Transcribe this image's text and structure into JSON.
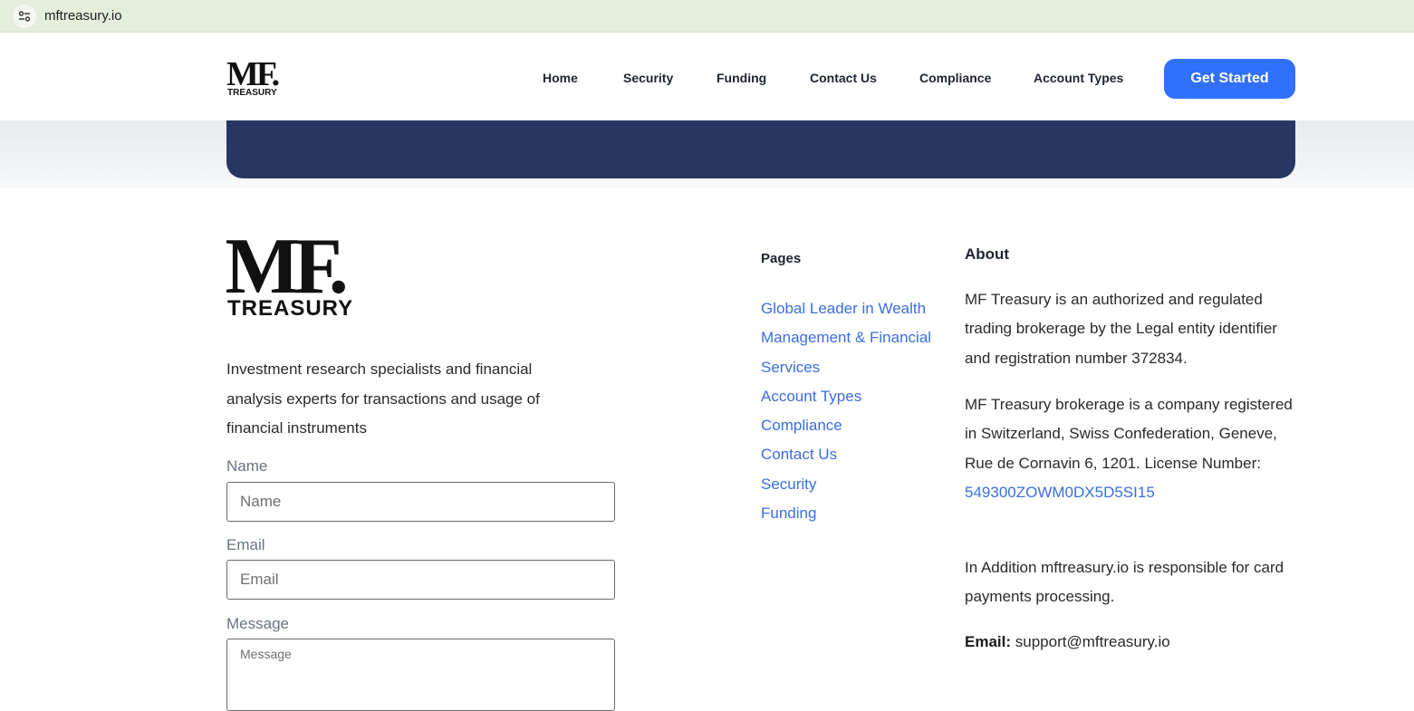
{
  "browser": {
    "url": "mftreasury.io"
  },
  "logo": {
    "mark": "MF.",
    "word": "TREASURY"
  },
  "nav": {
    "items": [
      {
        "label": "Home"
      },
      {
        "label": "Security"
      },
      {
        "label": "Funding"
      },
      {
        "label": "Contact Us"
      },
      {
        "label": "Compliance"
      },
      {
        "label": "Account Types"
      }
    ],
    "cta_label": "Get Started"
  },
  "footer": {
    "description": "Investment research specialists and financial analysis experts for transactions and usage of financial instruments",
    "form": {
      "name_label": "Name",
      "name_placeholder": "Name",
      "email_label": "Email",
      "email_placeholder": "Email",
      "message_label": "Message",
      "message_placeholder": "Message"
    },
    "pages": {
      "title": "Pages",
      "links": [
        {
          "label": "Global Leader in Wealth Management & Financial Services"
        },
        {
          "label": "Account Types"
        },
        {
          "label": "Compliance"
        },
        {
          "label": "Contact Us"
        },
        {
          "label": "Security"
        },
        {
          "label": "Funding"
        }
      ]
    },
    "about": {
      "title": "About",
      "p1": "MF Treasury is an authorized and regulated trading brokerage by the Legal entity identifier and registration number 372834.",
      "p2": "MF Treasury brokerage is a company registered in Switzerland, Swiss Confederation, Geneve, Rue de Cornavin 6, 1201. License Number:",
      "license_number": "549300ZOWM0DX5D5SI15",
      "p3": "In Addition mftreasury.io is responsible for card payments processing.",
      "email_label": "Email:",
      "email_value": "support@mftreasury.io"
    }
  },
  "colors": {
    "primary": "#3170fb",
    "banner": "#273764",
    "link": "#3a6ee0"
  }
}
